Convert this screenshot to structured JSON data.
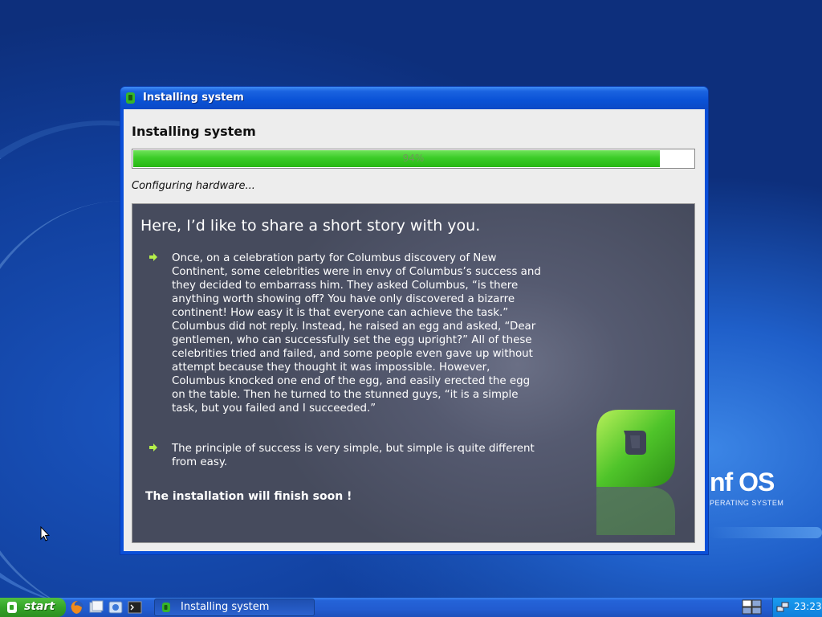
{
  "window": {
    "title": "Installing system",
    "heading": "Installing system",
    "progress": {
      "percent": 94,
      "label": "94%"
    },
    "status": "Configuring hardware..."
  },
  "slide": {
    "title": "Here, I’d like to share a short story with you.",
    "bullets": [
      "Once, on a celebration party for Columbus discovery of New Continent, some celebrities were in envy of Columbus’s success and they decided to embarrass him. They asked Columbus, “is there anything worth showing off? You have only discovered a bizarre continent! How easy it is that everyone can achieve the task.” Columbus did not reply. Instead, he raised an egg and asked, “Dear gentlemen, who can successfully set the egg upright?” All of these celebrities tried and failed, and some people even gave up without attempt because they thought it was impossible. However, Columbus knocked one end of the egg, and easily erected the egg on the table. Then he turned to the stunned guys, “it is a simple task, but you failed and I succeeded.”",
      "The principle of success is very simple, but simple is quite different from easy."
    ],
    "footer": "The installation will finish soon !"
  },
  "desktop": {
    "brand_name": "nf OS",
    "brand_sub": "PERATING SYSTEM"
  },
  "taskbar": {
    "start_label": "start",
    "quick_launch": [
      "firefox-icon",
      "files-icon",
      "browser-icon",
      "terminal-icon"
    ],
    "task_label": "Installing system",
    "clock": "23:23"
  },
  "colors": {
    "progress_green": "#3ccc28",
    "slide_bg": "#4e5367",
    "titlebar_blue": "#0a52d6",
    "start_green": "#35a428"
  }
}
